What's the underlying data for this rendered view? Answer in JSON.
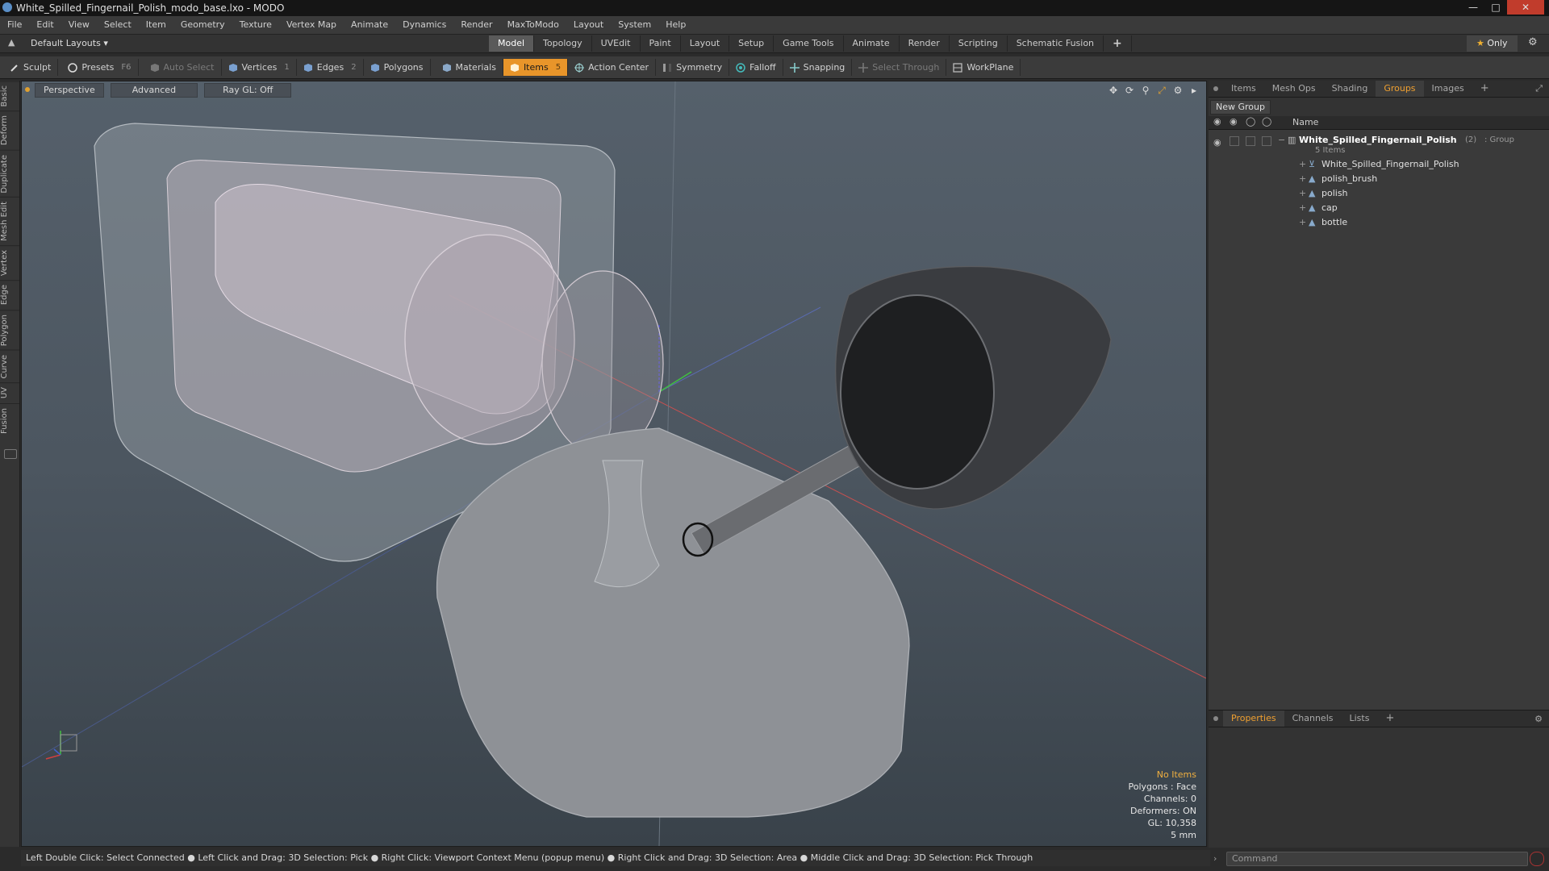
{
  "window": {
    "title": "White_Spilled_Fingernail_Polish_modo_base.lxo - MODO"
  },
  "menu": [
    "File",
    "Edit",
    "View",
    "Select",
    "Item",
    "Geometry",
    "Texture",
    "Vertex Map",
    "Animate",
    "Dynamics",
    "Render",
    "MaxToModo",
    "Layout",
    "System",
    "Help"
  ],
  "layouts": {
    "dropdown": "Default Layouts",
    "only_label": "Only"
  },
  "layout_tabs": [
    "Model",
    "Topology",
    "UVEdit",
    "Paint",
    "Layout",
    "Setup",
    "Game Tools",
    "Animate",
    "Render",
    "Scripting",
    "Schematic Fusion"
  ],
  "toolbar": {
    "sculpt": "Sculpt",
    "presets": "Presets",
    "presets_key": "F6",
    "auto_select": "Auto Select",
    "vertices": "Vertices",
    "vertices_count": "1",
    "edges": "Edges",
    "edges_count": "2",
    "polygons": "Polygons",
    "materials": "Materials",
    "items": "Items",
    "items_count": "5",
    "action_center": "Action Center",
    "symmetry": "Symmetry",
    "falloff": "Falloff",
    "snapping": "Snapping",
    "select_through": "Select Through",
    "workplane": "WorkPlane"
  },
  "left_tabs": [
    "Basic",
    "Deform",
    "Duplicate",
    "Mesh Edit",
    "Vertex",
    "Edge",
    "Polygon",
    "Curve",
    "UV",
    "Fusion"
  ],
  "viewport": {
    "perspective": "Perspective",
    "advanced": "Advanced",
    "raygl": "Ray GL: Off",
    "info": {
      "no_items": "No Items",
      "polygons": "Polygons : Face",
      "channels": "Channels: 0",
      "deformers": "Deformers: ON",
      "gl": "GL: 10,358",
      "scale": "5 mm"
    }
  },
  "statusbar": "Left Double Click: Select Connected ● Left Click and Drag: 3D Selection: Pick ● Right Click: Viewport Context Menu (popup menu) ● Right Click and Drag: 3D Selection: Area ● Middle Click and Drag: 3D Selection: Pick Through",
  "right_panel": {
    "tabs": [
      "Items",
      "Mesh Ops",
      "Shading",
      "Groups",
      "Images"
    ],
    "active_tab": "Groups",
    "new_group": "New Group",
    "name_header": "Name",
    "group": {
      "name": "White_Spilled_Fingernail_Polish",
      "count": "(2)",
      "type": ": Group",
      "sub": "5 Items"
    },
    "items": [
      "White_Spilled_Fingernail_Polish",
      "polish_brush",
      "polish",
      "cap",
      "bottle"
    ]
  },
  "bottom_panel": {
    "tabs": [
      "Properties",
      "Channels",
      "Lists"
    ],
    "active": "Properties"
  },
  "command": {
    "placeholder": "Command"
  },
  "colors": {
    "accent": "#e8952a",
    "viewport_bg": "#4c5660"
  }
}
